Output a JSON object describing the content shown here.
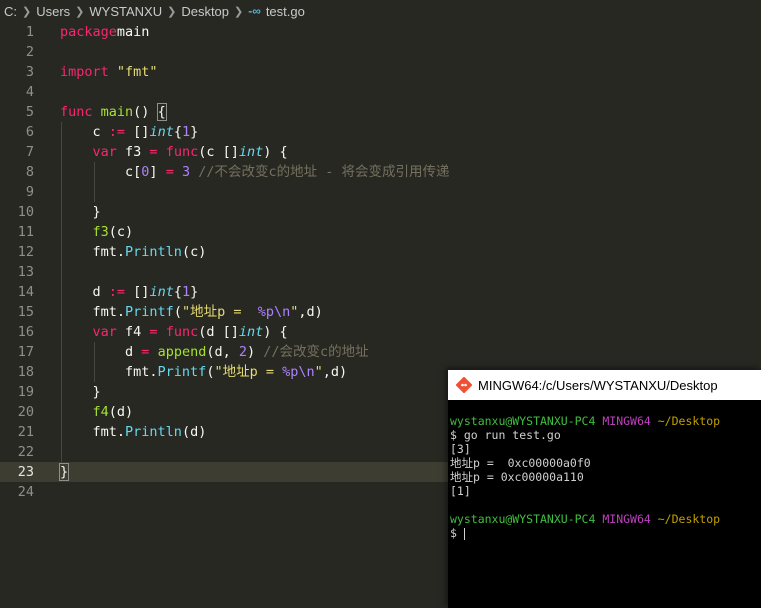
{
  "breadcrumb": {
    "items": [
      "C:",
      "Users",
      "WYSTANXU",
      "Desktop"
    ],
    "file_icon": "go-file-icon",
    "file": "test.go"
  },
  "editor": {
    "lines": [
      {
        "n": "1",
        "tokens": [
          [
            "kw",
            "package"
          ],
          [
            "",
            "main"
          ]
        ]
      },
      {
        "n": "2",
        "tokens": []
      },
      {
        "n": "3",
        "tokens": [
          [
            "kw",
            "import"
          ],
          [
            "",
            ""
          ],
          [
            "str",
            "\"fmt\""
          ]
        ]
      },
      {
        "n": "4",
        "tokens": []
      },
      {
        "n": "5",
        "tokens": [
          [
            "kw",
            "func"
          ],
          [
            "",
            " "
          ],
          [
            "fn",
            "main"
          ],
          [
            "",
            "() "
          ],
          [
            "brk",
            "{"
          ]
        ]
      },
      {
        "n": "6",
        "tokens": [
          [
            "",
            "    c "
          ],
          [
            "kw",
            ":="
          ],
          [
            "",
            " []"
          ],
          [
            "ty",
            "int"
          ],
          [
            "",
            "{"
          ],
          [
            "num",
            "1"
          ],
          [
            "",
            "}"
          ]
        ]
      },
      {
        "n": "7",
        "tokens": [
          [
            "",
            "    "
          ],
          [
            "kw",
            "var"
          ],
          [
            "",
            " f3 "
          ],
          [
            "kw",
            "="
          ],
          [
            "",
            " "
          ],
          [
            "kw",
            "func"
          ],
          [
            "",
            "(c []"
          ],
          [
            "ty",
            "int"
          ],
          [
            "",
            ") {"
          ]
        ]
      },
      {
        "n": "8",
        "tokens": [
          [
            "",
            "        c["
          ],
          [
            "num",
            "0"
          ],
          [
            "",
            "] "
          ],
          [
            "kw",
            "="
          ],
          [
            "",
            " "
          ],
          [
            "num",
            "3"
          ],
          [
            "",
            " "
          ],
          [
            "cm",
            "//不会改变c的地址 - 将会变成引用传递"
          ]
        ]
      },
      {
        "n": "9",
        "tokens": []
      },
      {
        "n": "10",
        "tokens": [
          [
            "",
            "    }"
          ]
        ]
      },
      {
        "n": "11",
        "tokens": [
          [
            "",
            "    "
          ],
          [
            "fn",
            "f3"
          ],
          [
            "",
            "(c)"
          ]
        ]
      },
      {
        "n": "12",
        "tokens": [
          [
            "",
            "    fmt."
          ],
          [
            "mt",
            "Println"
          ],
          [
            "",
            "(c)"
          ]
        ]
      },
      {
        "n": "13",
        "tokens": []
      },
      {
        "n": "14",
        "tokens": [
          [
            "",
            "    d "
          ],
          [
            "kw",
            ":="
          ],
          [
            "",
            " []"
          ],
          [
            "ty",
            "int"
          ],
          [
            "",
            "{"
          ],
          [
            "num",
            "1"
          ],
          [
            "",
            "}"
          ]
        ]
      },
      {
        "n": "15",
        "tokens": [
          [
            "",
            "    fmt."
          ],
          [
            "mt",
            "Printf"
          ],
          [
            "",
            "("
          ],
          [
            "str",
            "\"地址p =  "
          ],
          [
            "esc",
            "%p\\n"
          ],
          [
            "str",
            "\""
          ],
          [
            "",
            ",d)"
          ]
        ]
      },
      {
        "n": "16",
        "tokens": [
          [
            "",
            "    "
          ],
          [
            "kw",
            "var"
          ],
          [
            "",
            " f4 "
          ],
          [
            "kw",
            "="
          ],
          [
            "",
            " "
          ],
          [
            "kw",
            "func"
          ],
          [
            "",
            "(d []"
          ],
          [
            "ty",
            "int"
          ],
          [
            "",
            ") {"
          ]
        ]
      },
      {
        "n": "17",
        "tokens": [
          [
            "",
            "        d "
          ],
          [
            "kw",
            "="
          ],
          [
            "",
            " "
          ],
          [
            "fn",
            "append"
          ],
          [
            "",
            "(d, "
          ],
          [
            "num",
            "2"
          ],
          [
            "",
            ") "
          ],
          [
            "cm",
            "//会改变c的地址"
          ]
        ]
      },
      {
        "n": "18",
        "tokens": [
          [
            "",
            "        fmt."
          ],
          [
            "mt",
            "Printf"
          ],
          [
            "",
            "("
          ],
          [
            "str",
            "\"地址p = "
          ],
          [
            "esc",
            "%p\\n"
          ],
          [
            "str",
            "\""
          ],
          [
            "",
            ",d)"
          ]
        ]
      },
      {
        "n": "19",
        "tokens": [
          [
            "",
            "    }"
          ]
        ]
      },
      {
        "n": "20",
        "tokens": [
          [
            "",
            "    "
          ],
          [
            "fn",
            "f4"
          ],
          [
            "",
            "(d)"
          ]
        ]
      },
      {
        "n": "21",
        "tokens": [
          [
            "",
            "    fmt."
          ],
          [
            "mt",
            "Println"
          ],
          [
            "",
            "(d)"
          ]
        ]
      },
      {
        "n": "22",
        "tokens": []
      },
      {
        "n": "23",
        "tokens": [
          [
            "brk",
            "}"
          ]
        ],
        "current": true
      },
      {
        "n": "24",
        "tokens": []
      }
    ]
  },
  "terminal": {
    "title": "MINGW64:/c/Users/WYSTANXU/Desktop",
    "prompt_user": "wystanxu@WYSTANXU-PC4",
    "prompt_host": "MINGW64",
    "prompt_path": "~/Desktop",
    "command": "$ go run test.go",
    "output": [
      "[3]",
      "地址p =  0xc00000a0f0",
      "地址p = 0xc00000a110",
      "[1]"
    ],
    "final_prompt": "$ "
  },
  "colors": {
    "editor_bg": "#272822",
    "keyword": "#f92672",
    "function": "#a6e22e",
    "type": "#66d9ef",
    "number": "#ae81ff",
    "string": "#e6db74",
    "comment": "#75715e",
    "terminal_bg": "#000000"
  }
}
